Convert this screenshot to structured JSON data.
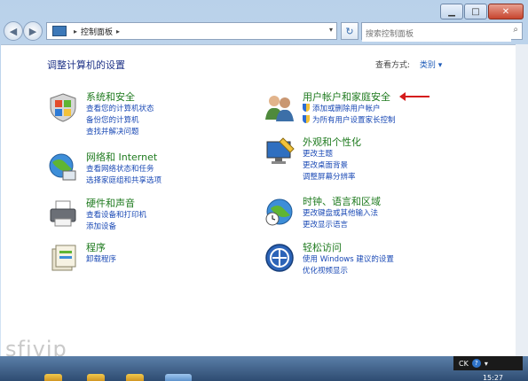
{
  "address": {
    "path_item": "控制面板",
    "search_placeholder": "搜索控制面板"
  },
  "header": {
    "title": "调整计算机的设置",
    "view_by_label": "查看方式:",
    "view_by_value": "类别"
  },
  "categories_left": [
    {
      "title": "系统和安全",
      "icon": "shield-flag-icon",
      "links": [
        "查看您的计算机状态",
        "备份您的计算机",
        "查找并解决问题"
      ]
    },
    {
      "title": "网络和 Internet",
      "icon": "globe-network-icon",
      "links": [
        "查看网络状态和任务",
        "选择家庭组和共享选项"
      ]
    },
    {
      "title": "硬件和声音",
      "icon": "printer-icon",
      "links": [
        "查看设备和打印机",
        "添加设备"
      ]
    },
    {
      "title": "程序",
      "icon": "programs-icon",
      "links": [
        "卸载程序"
      ]
    }
  ],
  "categories_right": [
    {
      "title": "用户帐户和家庭安全",
      "icon": "users-icon",
      "links": [
        "添加或删除用户帐户",
        "为所有用户设置家长控制"
      ]
    },
    {
      "title": "外观和个性化",
      "icon": "monitor-paint-icon",
      "links": [
        "更改主题",
        "更改桌面背景",
        "调整屏幕分辨率"
      ]
    },
    {
      "title": "时钟、语言和区域",
      "icon": "clock-globe-icon",
      "links": [
        "更改键盘或其他输入法",
        "更改显示语言"
      ]
    },
    {
      "title": "轻松访问",
      "icon": "accessibility-icon",
      "links": [
        "使用 Windows 建议的设置",
        "优化视频显示"
      ]
    }
  ],
  "watermark": "sfjvip",
  "taskbar": {
    "language": "CK",
    "clock": "15:27"
  }
}
